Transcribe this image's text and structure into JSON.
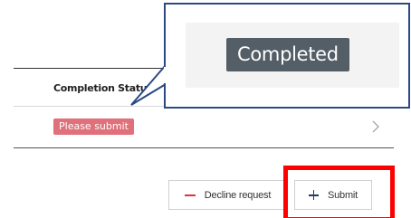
{
  "table": {
    "header_label": "Completion Status"
  },
  "row": {
    "status_badge": "Please submit",
    "badge_color": "#e0707a"
  },
  "actions": {
    "decline_label": "Decline request",
    "submit_label": "Submit",
    "decline_icon_color": "#d9353b",
    "submit_icon_color": "#1f3b66"
  },
  "callout": {
    "badge_label": "Completed",
    "badge_color": "#545e66",
    "border_color": "#2b4a84"
  },
  "highlight": {
    "color": "#ff0000"
  },
  "icons": {
    "decline": "minus-icon",
    "submit": "plus-icon",
    "row": "chevron-right-icon"
  }
}
